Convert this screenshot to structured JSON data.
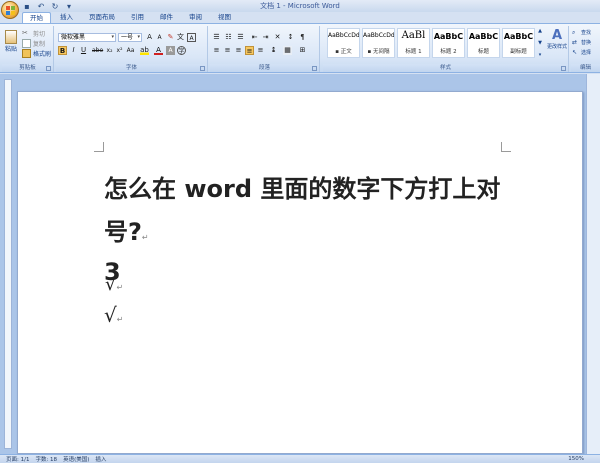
{
  "window": {
    "title": "文档 1 - Microsoft Word"
  },
  "tabs": [
    {
      "label": "开始",
      "active": true
    },
    {
      "label": "插入"
    },
    {
      "label": "页面布局"
    },
    {
      "label": "引用"
    },
    {
      "label": "邮件"
    },
    {
      "label": "审阅"
    },
    {
      "label": "视图"
    }
  ],
  "clipboard": {
    "paste": "粘贴",
    "cut": "剪切",
    "copy": "复制",
    "format_painter": "格式刷",
    "label": "剪贴板"
  },
  "font": {
    "name": "微软雅黑",
    "size": "一号",
    "label": "字体"
  },
  "paragraph": {
    "label": "段落"
  },
  "styles": {
    "label": "样式",
    "items": [
      {
        "sample": "AaBbCcDd",
        "caption": "▪ 正文"
      },
      {
        "sample": "AaBbCcDd",
        "caption": "▪ 无间隔"
      },
      {
        "sample": "AaBl",
        "caption": "标题 1"
      },
      {
        "sample": "AaBbC",
        "caption": "标题 2"
      },
      {
        "sample": "AaBbC",
        "caption": "标题"
      },
      {
        "sample": "AaBbC",
        "caption": "副标题"
      }
    ],
    "change_styles": "更改样式"
  },
  "editing": {
    "find": "查找",
    "replace": "替换",
    "select": "选择",
    "label": "编辑"
  },
  "document": {
    "line1": "怎么在 word 里面的数字下方打上对",
    "line2": "号?",
    "line3": "3",
    "check1": "√",
    "check2": "√"
  },
  "status": {
    "page": "页面: 1/1",
    "words": "字数: 18",
    "lang": "英语(美国)",
    "mode": "插入",
    "zoom": "150%"
  },
  "colors": {
    "accent": "#15428b",
    "ribbon": "#d9e6f7",
    "workspace": "#abc5e8"
  }
}
